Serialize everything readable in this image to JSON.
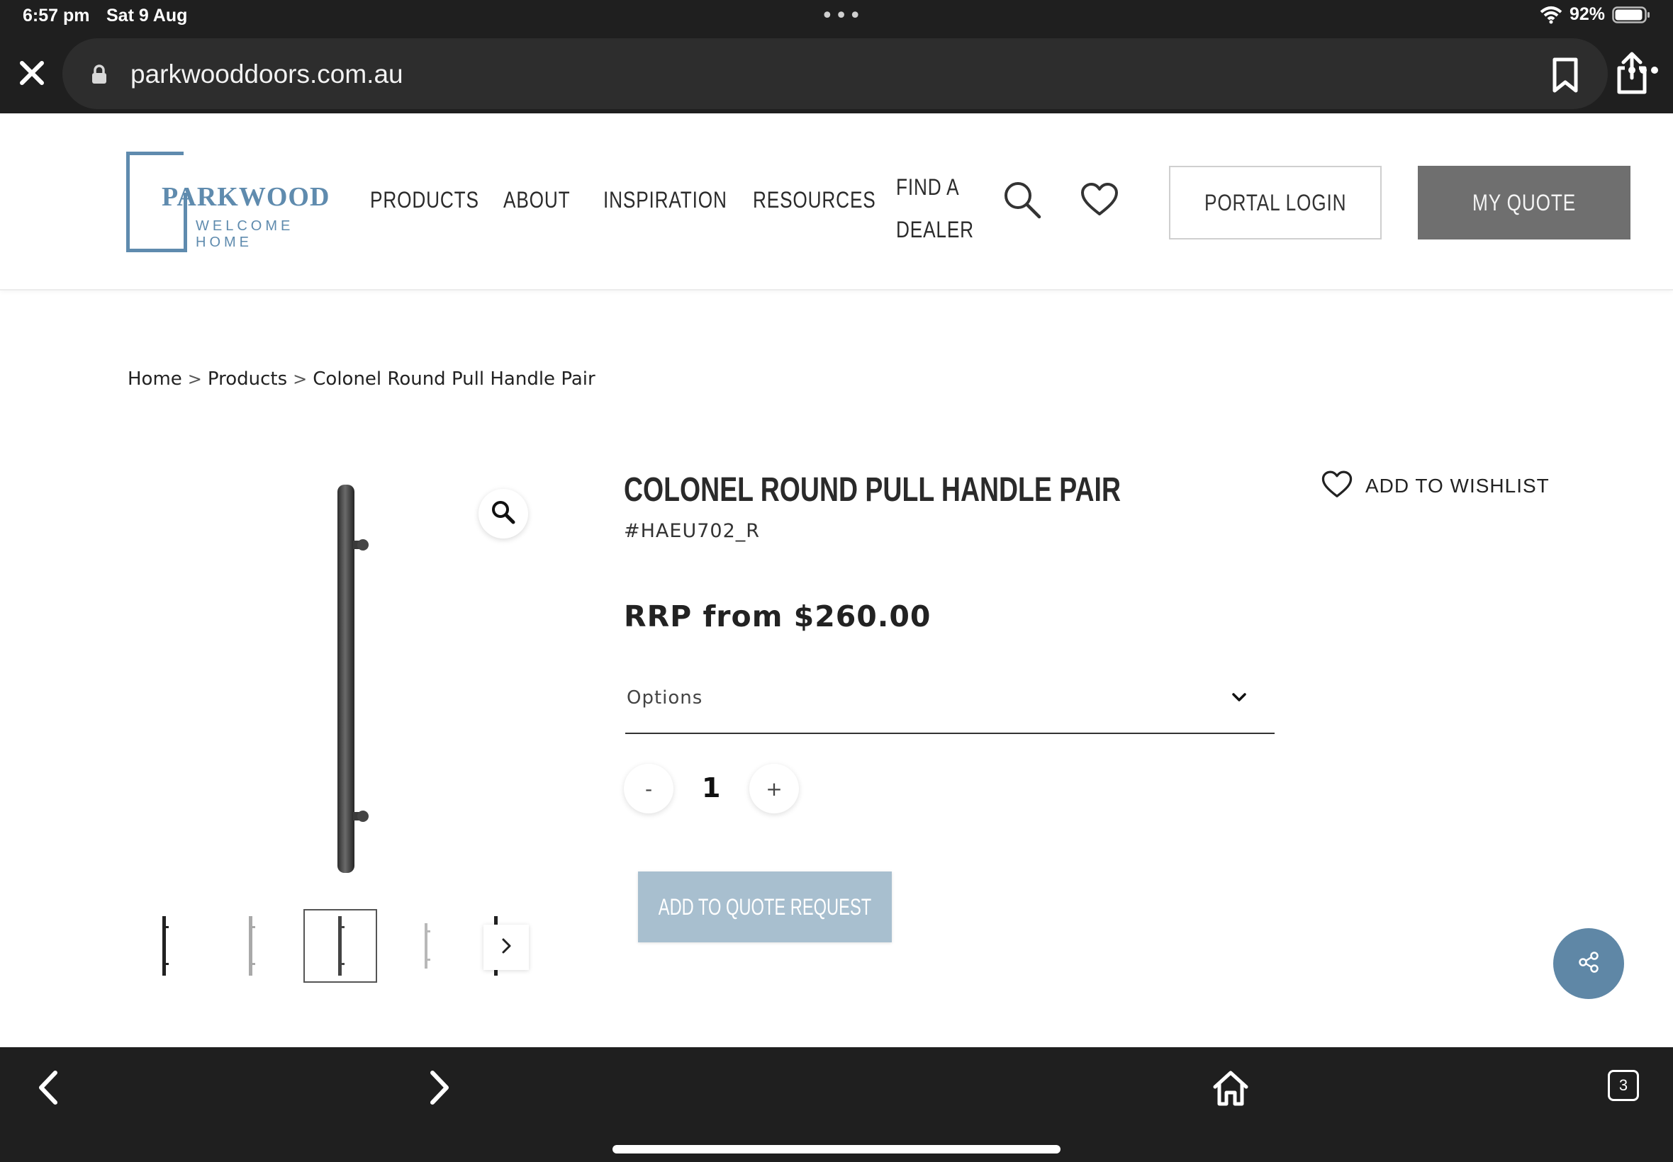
{
  "status_bar": {
    "time": "6:57 pm",
    "date": "Sat 9 Aug",
    "battery": "92%"
  },
  "browser": {
    "url": "parkwooddoors.com.au",
    "tab_count": "3"
  },
  "header": {
    "logo_word": "PARKWOOD",
    "logo_tagline": "WELCOME HOME",
    "nav": [
      "PRODUCTS",
      "ABOUT",
      "INSPIRATION",
      "RESOURCES",
      "FIND A DEALER"
    ],
    "portal_login": "PORTAL LOGIN",
    "my_quote": "MY QUOTE"
  },
  "breadcrumb": {
    "items": [
      "Home",
      "Products",
      "Colonel Round Pull Handle Pair"
    ],
    "separator": ">"
  },
  "product": {
    "title": "COLONEL ROUND PULL HANDLE PAIR",
    "sku": "#HAEU702_R",
    "price": "RRP from $260.00",
    "options_label": "Options",
    "quantity": "1",
    "qty_minus": "-",
    "qty_plus": "+",
    "add_to_quote": "ADD TO QUOTE REQUEST",
    "wishlist": "ADD TO WISHLIST"
  },
  "colors": {
    "brand_blue": "#5f8bae",
    "add_quote_bg": "#a8bfcf",
    "my_quote_bg": "#6f6f6f",
    "chrome_bg": "#1f1f1f"
  }
}
